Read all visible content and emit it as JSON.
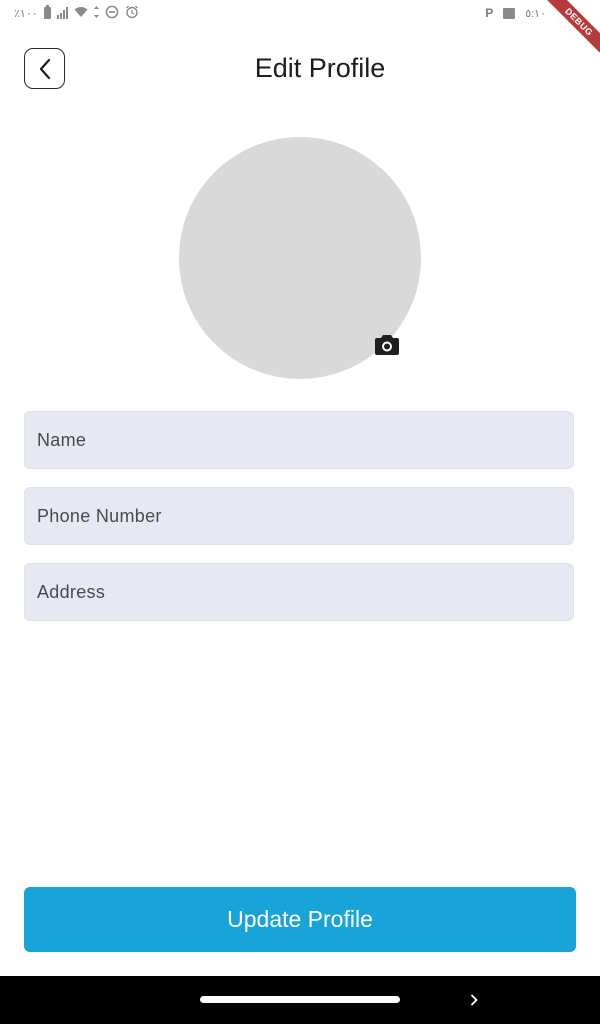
{
  "status_bar": {
    "battery_text": "٪١٠٠",
    "time": "٥:١٠",
    "right_app_icon": "P",
    "icons": [
      "battery-icon",
      "signal-icon",
      "wifi-icon",
      "data-arrows-icon",
      "do-not-disturb-icon",
      "alarm-icon",
      "parking-icon",
      "image-icon"
    ]
  },
  "debug_banner": "DEBUG",
  "header": {
    "title": "Edit Profile",
    "back_icon": "chevron-left-icon"
  },
  "avatar": {
    "camera_icon": "camera-icon"
  },
  "form": {
    "name_placeholder": "Name",
    "name_value": "",
    "phone_placeholder": "Phone Number",
    "phone_value": "",
    "address_placeholder": "Address",
    "address_value": ""
  },
  "actions": {
    "update_label": "Update Profile"
  },
  "nav_bar": {
    "forward_icon": "chevron-right-icon"
  },
  "colors": {
    "primary": "#18a4d8",
    "field_background": "#e6e9f3",
    "avatar_placeholder": "#d9d9d9",
    "debug_ribbon": "#b73a3a"
  }
}
